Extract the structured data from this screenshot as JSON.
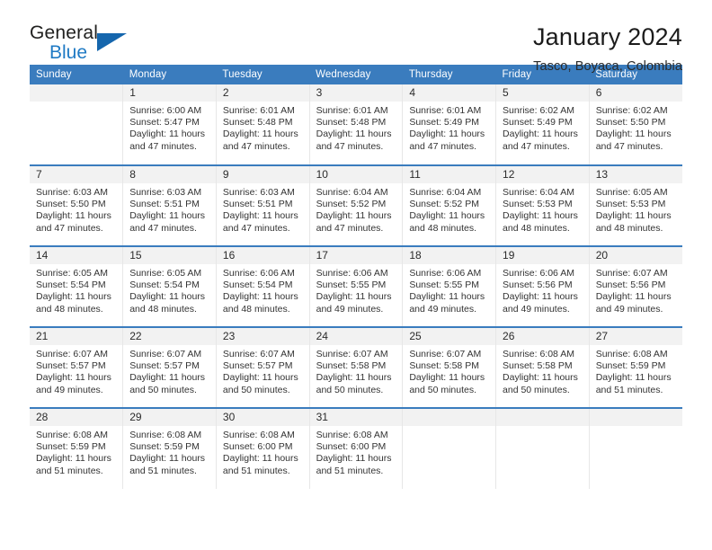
{
  "brand": {
    "name_top": "General",
    "name_bottom": "Blue",
    "triangle_color": "#1566ad",
    "accent_color": "#1f7ac4"
  },
  "header": {
    "title": "January 2024",
    "subtitle": "Tasco, Boyaca, Colombia"
  },
  "theme": {
    "header_bar": "#3a7cbe",
    "daynum_band": "#f2f2f2",
    "cell_border": "#e7e7e7",
    "text": "#333333"
  },
  "calendar": {
    "weekday_headers": [
      "Sunday",
      "Monday",
      "Tuesday",
      "Wednesday",
      "Thursday",
      "Friday",
      "Saturday"
    ],
    "labels": {
      "sunrise": "Sunrise:",
      "sunset": "Sunset:",
      "daylight": "Daylight:"
    },
    "weeks": [
      [
        {
          "day": "",
          "empty": true
        },
        {
          "day": "1",
          "sunrise": "Sunrise: 6:00 AM",
          "sunset": "Sunset: 5:47 PM",
          "daylight_1": "Daylight: 11 hours",
          "daylight_2": "and 47 minutes."
        },
        {
          "day": "2",
          "sunrise": "Sunrise: 6:01 AM",
          "sunset": "Sunset: 5:48 PM",
          "daylight_1": "Daylight: 11 hours",
          "daylight_2": "and 47 minutes."
        },
        {
          "day": "3",
          "sunrise": "Sunrise: 6:01 AM",
          "sunset": "Sunset: 5:48 PM",
          "daylight_1": "Daylight: 11 hours",
          "daylight_2": "and 47 minutes."
        },
        {
          "day": "4",
          "sunrise": "Sunrise: 6:01 AM",
          "sunset": "Sunset: 5:49 PM",
          "daylight_1": "Daylight: 11 hours",
          "daylight_2": "and 47 minutes."
        },
        {
          "day": "5",
          "sunrise": "Sunrise: 6:02 AM",
          "sunset": "Sunset: 5:49 PM",
          "daylight_1": "Daylight: 11 hours",
          "daylight_2": "and 47 minutes."
        },
        {
          "day": "6",
          "sunrise": "Sunrise: 6:02 AM",
          "sunset": "Sunset: 5:50 PM",
          "daylight_1": "Daylight: 11 hours",
          "daylight_2": "and 47 minutes."
        }
      ],
      [
        {
          "day": "7",
          "sunrise": "Sunrise: 6:03 AM",
          "sunset": "Sunset: 5:50 PM",
          "daylight_1": "Daylight: 11 hours",
          "daylight_2": "and 47 minutes."
        },
        {
          "day": "8",
          "sunrise": "Sunrise: 6:03 AM",
          "sunset": "Sunset: 5:51 PM",
          "daylight_1": "Daylight: 11 hours",
          "daylight_2": "and 47 minutes."
        },
        {
          "day": "9",
          "sunrise": "Sunrise: 6:03 AM",
          "sunset": "Sunset: 5:51 PM",
          "daylight_1": "Daylight: 11 hours",
          "daylight_2": "and 47 minutes."
        },
        {
          "day": "10",
          "sunrise": "Sunrise: 6:04 AM",
          "sunset": "Sunset: 5:52 PM",
          "daylight_1": "Daylight: 11 hours",
          "daylight_2": "and 47 minutes."
        },
        {
          "day": "11",
          "sunrise": "Sunrise: 6:04 AM",
          "sunset": "Sunset: 5:52 PM",
          "daylight_1": "Daylight: 11 hours",
          "daylight_2": "and 48 minutes."
        },
        {
          "day": "12",
          "sunrise": "Sunrise: 6:04 AM",
          "sunset": "Sunset: 5:53 PM",
          "daylight_1": "Daylight: 11 hours",
          "daylight_2": "and 48 minutes."
        },
        {
          "day": "13",
          "sunrise": "Sunrise: 6:05 AM",
          "sunset": "Sunset: 5:53 PM",
          "daylight_1": "Daylight: 11 hours",
          "daylight_2": "and 48 minutes."
        }
      ],
      [
        {
          "day": "14",
          "sunrise": "Sunrise: 6:05 AM",
          "sunset": "Sunset: 5:54 PM",
          "daylight_1": "Daylight: 11 hours",
          "daylight_2": "and 48 minutes."
        },
        {
          "day": "15",
          "sunrise": "Sunrise: 6:05 AM",
          "sunset": "Sunset: 5:54 PM",
          "daylight_1": "Daylight: 11 hours",
          "daylight_2": "and 48 minutes."
        },
        {
          "day": "16",
          "sunrise": "Sunrise: 6:06 AM",
          "sunset": "Sunset: 5:54 PM",
          "daylight_1": "Daylight: 11 hours",
          "daylight_2": "and 48 minutes."
        },
        {
          "day": "17",
          "sunrise": "Sunrise: 6:06 AM",
          "sunset": "Sunset: 5:55 PM",
          "daylight_1": "Daylight: 11 hours",
          "daylight_2": "and 49 minutes."
        },
        {
          "day": "18",
          "sunrise": "Sunrise: 6:06 AM",
          "sunset": "Sunset: 5:55 PM",
          "daylight_1": "Daylight: 11 hours",
          "daylight_2": "and 49 minutes."
        },
        {
          "day": "19",
          "sunrise": "Sunrise: 6:06 AM",
          "sunset": "Sunset: 5:56 PM",
          "daylight_1": "Daylight: 11 hours",
          "daylight_2": "and 49 minutes."
        },
        {
          "day": "20",
          "sunrise": "Sunrise: 6:07 AM",
          "sunset": "Sunset: 5:56 PM",
          "daylight_1": "Daylight: 11 hours",
          "daylight_2": "and 49 minutes."
        }
      ],
      [
        {
          "day": "21",
          "sunrise": "Sunrise: 6:07 AM",
          "sunset": "Sunset: 5:57 PM",
          "daylight_1": "Daylight: 11 hours",
          "daylight_2": "and 49 minutes."
        },
        {
          "day": "22",
          "sunrise": "Sunrise: 6:07 AM",
          "sunset": "Sunset: 5:57 PM",
          "daylight_1": "Daylight: 11 hours",
          "daylight_2": "and 50 minutes."
        },
        {
          "day": "23",
          "sunrise": "Sunrise: 6:07 AM",
          "sunset": "Sunset: 5:57 PM",
          "daylight_1": "Daylight: 11 hours",
          "daylight_2": "and 50 minutes."
        },
        {
          "day": "24",
          "sunrise": "Sunrise: 6:07 AM",
          "sunset": "Sunset: 5:58 PM",
          "daylight_1": "Daylight: 11 hours",
          "daylight_2": "and 50 minutes."
        },
        {
          "day": "25",
          "sunrise": "Sunrise: 6:07 AM",
          "sunset": "Sunset: 5:58 PM",
          "daylight_1": "Daylight: 11 hours",
          "daylight_2": "and 50 minutes."
        },
        {
          "day": "26",
          "sunrise": "Sunrise: 6:08 AM",
          "sunset": "Sunset: 5:58 PM",
          "daylight_1": "Daylight: 11 hours",
          "daylight_2": "and 50 minutes."
        },
        {
          "day": "27",
          "sunrise": "Sunrise: 6:08 AM",
          "sunset": "Sunset: 5:59 PM",
          "daylight_1": "Daylight: 11 hours",
          "daylight_2": "and 51 minutes."
        }
      ],
      [
        {
          "day": "28",
          "sunrise": "Sunrise: 6:08 AM",
          "sunset": "Sunset: 5:59 PM",
          "daylight_1": "Daylight: 11 hours",
          "daylight_2": "and 51 minutes."
        },
        {
          "day": "29",
          "sunrise": "Sunrise: 6:08 AM",
          "sunset": "Sunset: 5:59 PM",
          "daylight_1": "Daylight: 11 hours",
          "daylight_2": "and 51 minutes."
        },
        {
          "day": "30",
          "sunrise": "Sunrise: 6:08 AM",
          "sunset": "Sunset: 6:00 PM",
          "daylight_1": "Daylight: 11 hours",
          "daylight_2": "and 51 minutes."
        },
        {
          "day": "31",
          "sunrise": "Sunrise: 6:08 AM",
          "sunset": "Sunset: 6:00 PM",
          "daylight_1": "Daylight: 11 hours",
          "daylight_2": "and 51 minutes."
        },
        {
          "day": "",
          "empty": true
        },
        {
          "day": "",
          "empty": true
        },
        {
          "day": "",
          "empty": true
        }
      ]
    ]
  }
}
